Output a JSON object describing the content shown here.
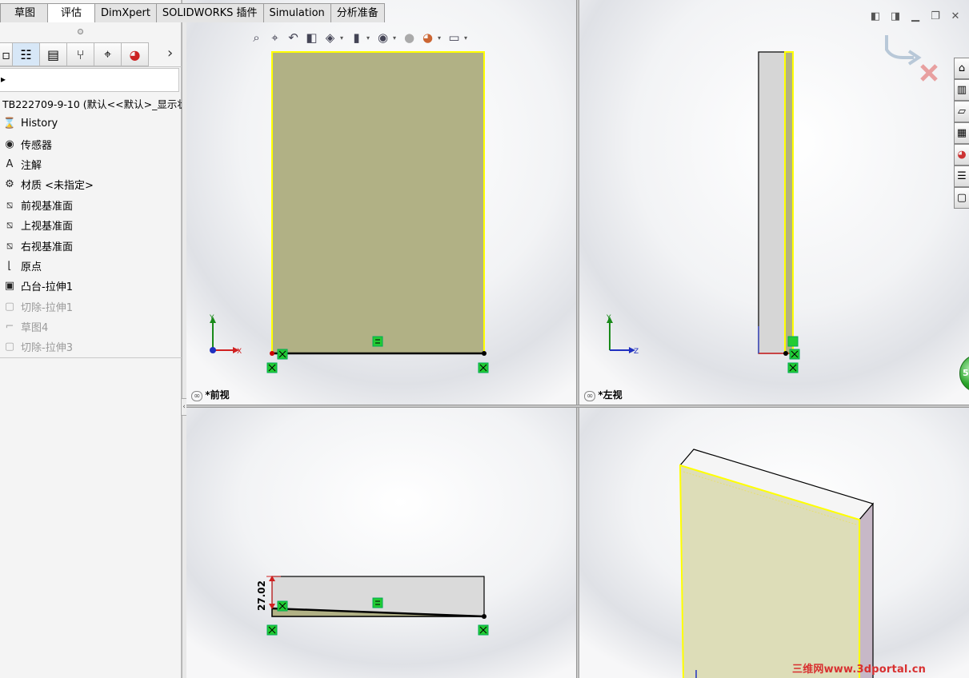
{
  "command_tabs": [
    "草图",
    "评估",
    "DimXpert",
    "SOLIDWORKS 插件",
    "Simulation",
    "分析准备"
  ],
  "manager_tabs": {
    "icons": [
      "partial-tab-icon",
      "featuremanager-tree-icon",
      "property-manager-icon",
      "configuration-manager-icon",
      "dimxpert-manager-icon",
      "display-manager-icon"
    ],
    "more": "›"
  },
  "filter": {
    "caret": "▸"
  },
  "tree": {
    "root_label": "TB222709-9-10  (默认<<默认>_显示状态",
    "items": [
      {
        "label": "History",
        "icon": "history-folder-icon",
        "glyph": "⌛",
        "dim": false
      },
      {
        "label": "传感器",
        "icon": "sensor-icon",
        "glyph": "◉",
        "dim": false
      },
      {
        "label": "注解",
        "icon": "annotation-icon",
        "glyph": "A",
        "dim": false
      },
      {
        "label": "材质 <未指定>",
        "icon": "material-icon",
        "glyph": "⚙",
        "dim": false
      },
      {
        "label": "前视基准面",
        "icon": "plane-icon",
        "glyph": "⧅",
        "dim": false
      },
      {
        "label": "上视基准面",
        "icon": "plane-icon",
        "glyph": "⧅",
        "dim": false
      },
      {
        "label": "右视基准面",
        "icon": "plane-icon",
        "glyph": "⧅",
        "dim": false
      },
      {
        "label": "原点",
        "icon": "origin-icon",
        "glyph": "⌊",
        "dim": false
      },
      {
        "label": "凸台-拉伸1",
        "icon": "boss-extrude-icon",
        "glyph": "▣",
        "dim": false
      },
      {
        "label": "切除-拉伸1",
        "icon": "cut-extrude-icon",
        "glyph": "▢",
        "dim": true
      },
      {
        "label": "草图4",
        "icon": "sketch-icon",
        "glyph": "⌐",
        "dim": true
      },
      {
        "label": "切除-拉伸3",
        "icon": "cut-extrude-icon",
        "glyph": "▢",
        "dim": true
      }
    ]
  },
  "viewports": {
    "front": {
      "label": "*前视"
    },
    "left": {
      "label": "*左视"
    },
    "top": {
      "dimension": "27.02"
    },
    "iso": {}
  },
  "triad": {
    "front": {
      "y": "Y",
      "x": "X"
    },
    "left": {
      "y": "Y",
      "z": "Z"
    }
  },
  "hud_toolbar": {
    "buttons": [
      "zoom-to-fit-icon",
      "zoom-to-area-icon",
      "previous-view-icon",
      "section-view-icon",
      "view-orientation-icon",
      "display-style-icon",
      "hide-show-items-icon",
      "edit-appearance-icon",
      "apply-scene-icon",
      "view-settings-icon"
    ]
  },
  "window_controls": [
    "tile-left-icon",
    "tile-right-icon",
    "minimize-icon",
    "restore-icon",
    "close-icon"
  ],
  "task_pane": [
    "home-icon",
    "design-library-icon",
    "file-explorer-icon",
    "view-palette-icon",
    "appearances-icon",
    "custom-properties-icon",
    "forum-icon"
  ],
  "green_badge": "5",
  "watermark": "三维网www.3dportal.cn",
  "colors": {
    "face_front": "#b1b185",
    "edge_selected": "#ffff00",
    "relation_green": "#22cc33",
    "viewport_bg": "#ffffff"
  }
}
